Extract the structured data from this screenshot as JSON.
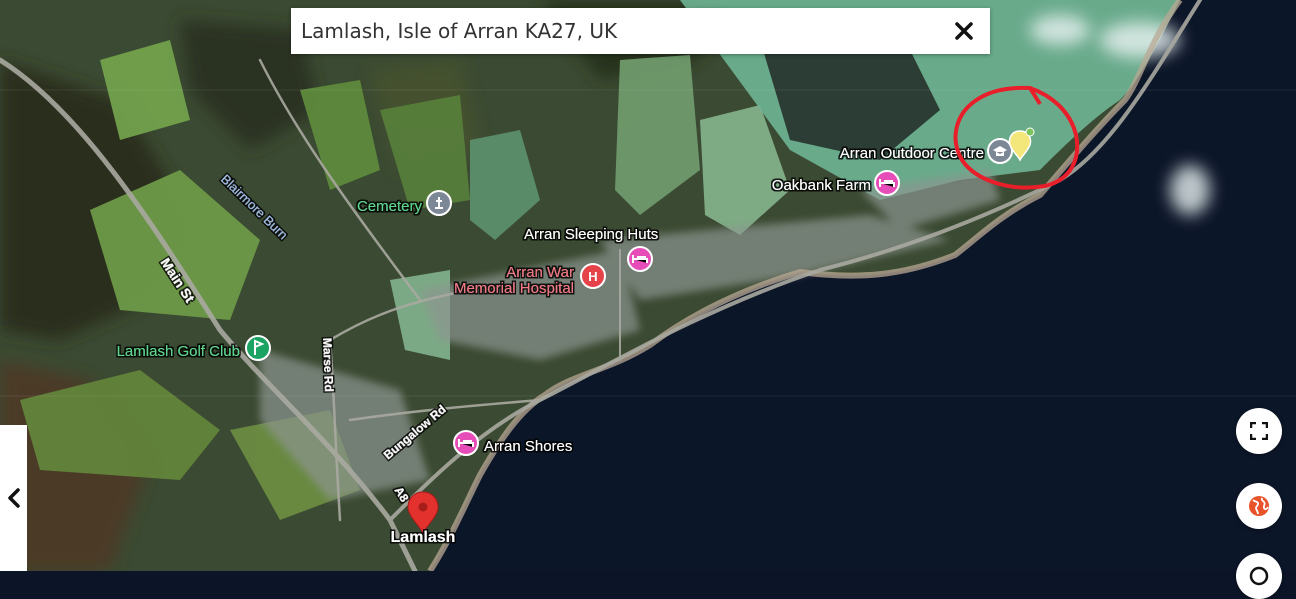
{
  "search": {
    "query": "Lamlash, Isle of Arran KA27, UK"
  },
  "map": {
    "places": [
      {
        "id": "cemetery",
        "label": "Cemetery",
        "color": "#3ec06a",
        "icon": "cemetery-icon"
      },
      {
        "id": "arran-sleeping-huts",
        "label": "Arran Sleeping Huts",
        "color": "#ffffff",
        "icon": "hotel-icon"
      },
      {
        "id": "arran-war-memorial-hospital",
        "label_line1": "Arran War",
        "label_line2": "Memorial Hospital",
        "color": "#f07a85",
        "icon": "hospital-icon"
      },
      {
        "id": "lamlash-golf-club",
        "label": "Lamlash Golf Club",
        "color": "#3ec06a",
        "icon": "golf-icon"
      },
      {
        "id": "arran-outdoor-centre",
        "label": "Arran Outdoor Centre",
        "color": "#ffffff",
        "icon": "school-icon"
      },
      {
        "id": "oakbank-farm",
        "label": "Oakbank Farm",
        "color": "#ffffff",
        "icon": "hotel-icon"
      },
      {
        "id": "arran-shores",
        "label": "Arran Shores",
        "color": "#ffffff",
        "icon": "hotel-icon"
      },
      {
        "id": "lamlash",
        "label": "Lamlash",
        "color": "#ffffff",
        "icon": "map-pin-icon"
      }
    ],
    "roads": [
      {
        "id": "main-st",
        "label": "Main St"
      },
      {
        "id": "blairmore-burn",
        "label": "Blairmore Burn"
      },
      {
        "id": "marse-rd",
        "label": "Marse Rd"
      },
      {
        "id": "bungalow-rd",
        "label": "Bungalow Rd"
      },
      {
        "id": "a841",
        "label": "A8"
      }
    ],
    "colors": {
      "pin": "#e3312d",
      "hotel_marker": "#e64db8",
      "hospital_marker": "#e5424a",
      "park_marker": "#1aa362",
      "gray_marker": "#7c8896",
      "annotation": "#e81f2a",
      "sea": "#0c1629"
    }
  }
}
